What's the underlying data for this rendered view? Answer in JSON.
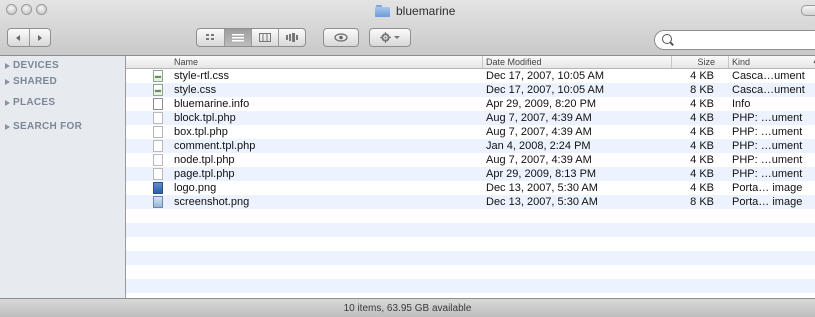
{
  "window": {
    "title": "bluemarine"
  },
  "toolbar": {
    "back_icon": "back-arrow-icon",
    "forward_icon": "forward-arrow-icon",
    "view_modes": [
      "icon-view-icon",
      "list-view-icon",
      "column-view-icon",
      "coverflow-view-icon"
    ],
    "active_view": 1,
    "quicklook_icon": "eye-icon",
    "action_icon": "gear-icon",
    "search_placeholder": ""
  },
  "sidebar": {
    "sections": [
      {
        "label": "DEVICES"
      },
      {
        "label": "SHARED"
      },
      {
        "label": "PLACES"
      },
      {
        "label": "SEARCH FOR"
      }
    ]
  },
  "list": {
    "columns": [
      "Name",
      "Date Modified",
      "Size",
      "Kind"
    ],
    "sort_indicator": "▲",
    "rows": [
      {
        "name": "style-rtl.css",
        "date": "Dec 17, 2007, 10:05 AM",
        "size": "4 KB",
        "kind": "Casca…ument",
        "icon": "css-file-icon"
      },
      {
        "name": "style.css",
        "date": "Dec 17, 2007, 10:05 AM",
        "size": "8 KB",
        "kind": "Casca…ument",
        "icon": "css-file-icon"
      },
      {
        "name": "bluemarine.info",
        "date": "Apr 29, 2009, 8:20 PM",
        "size": "4 KB",
        "kind": "Info",
        "icon": "document-icon"
      },
      {
        "name": "block.tpl.php",
        "date": "Aug 7, 2007, 4:39 AM",
        "size": "4 KB",
        "kind": "PHP: …ument",
        "icon": "php-file-icon"
      },
      {
        "name": "box.tpl.php",
        "date": "Aug 7, 2007, 4:39 AM",
        "size": "4 KB",
        "kind": "PHP: …ument",
        "icon": "php-file-icon"
      },
      {
        "name": "comment.tpl.php",
        "date": "Jan 4, 2008, 2:24 PM",
        "size": "4 KB",
        "kind": "PHP: …ument",
        "icon": "php-file-icon"
      },
      {
        "name": "node.tpl.php",
        "date": "Aug 7, 2007, 4:39 AM",
        "size": "4 KB",
        "kind": "PHP: …ument",
        "icon": "php-file-icon"
      },
      {
        "name": "page.tpl.php",
        "date": "Apr 29, 2009, 8:13 PM",
        "size": "4 KB",
        "kind": "PHP: …ument",
        "icon": "php-file-icon"
      },
      {
        "name": "logo.png",
        "date": "Dec 13, 2007, 5:30 AM",
        "size": "4 KB",
        "kind": "Porta… image",
        "icon": "png-image-icon"
      },
      {
        "name": "screenshot.png",
        "date": "Dec 13, 2007, 5:30 AM",
        "size": "8 KB",
        "kind": "Porta… image",
        "icon": "png-image-icon"
      }
    ]
  },
  "status": {
    "text": "10 items, 63.95 GB available"
  }
}
